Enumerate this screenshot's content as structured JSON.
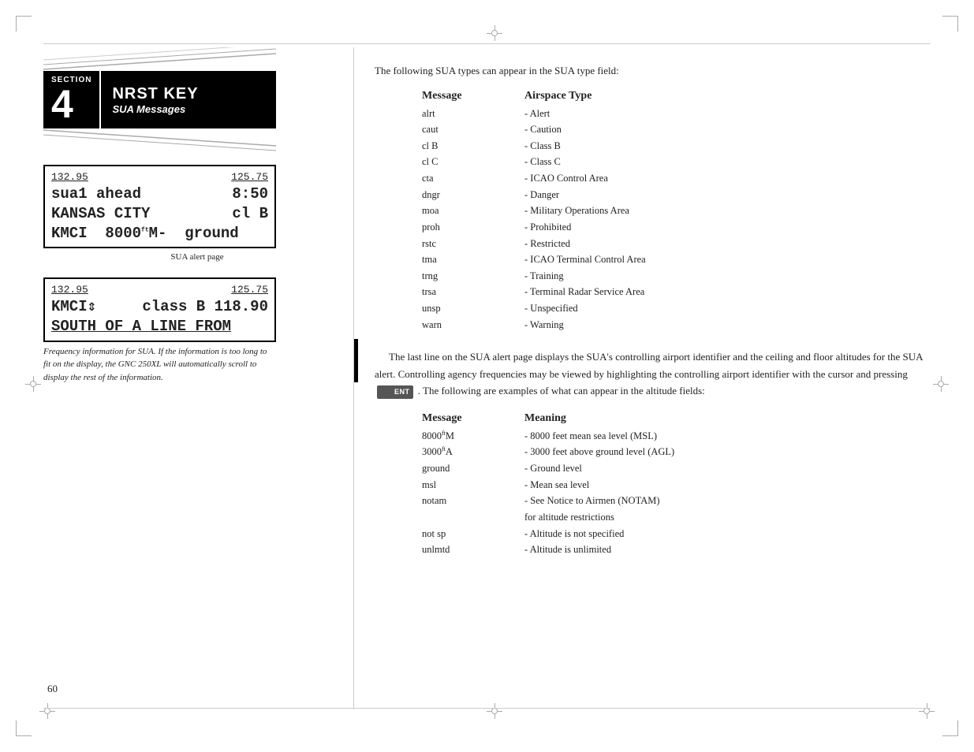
{
  "page": {
    "number": "60",
    "background": "#ffffff"
  },
  "section": {
    "word": "SECTION",
    "number": "4",
    "title_main": "NRST KEY",
    "title_sub": "SUA Messages"
  },
  "left_col": {
    "lcd1": {
      "row1_left": "132.95",
      "row1_right": "125.75",
      "row2_left": "sua1 ahead",
      "row2_right": "8:50",
      "row3_left": "KANSAS CITY",
      "row3_right": "cl B",
      "row4": "KMCI  8000ftM-  ground"
    },
    "caption1": "SUA alert page",
    "lcd2": {
      "row1_left": "132.95",
      "row1_right": "125.75",
      "row2_left": "KMCI⇕",
      "row2_right": "class B 118.90",
      "row3": "SOUTH OF A LINE FROM"
    },
    "caption2_italic": "Frequency information for SUA. If the information is too long to fit on the display, the GNC 250XL will automatically scroll to display the rest of the information."
  },
  "right_col": {
    "intro": "The following SUA types can appear in the SUA type field:",
    "sua_table": {
      "col1_header": "Message",
      "col2_header": "Airspace Type",
      "rows": [
        {
          "msg": "alrt",
          "type": "- Alert"
        },
        {
          "msg": "caut",
          "type": "- Caution"
        },
        {
          "msg": "cl B",
          "type": "- Class B"
        },
        {
          "msg": "cl C",
          "type": "- Class C"
        },
        {
          "msg": "cta",
          "type": "- ICAO Control Area"
        },
        {
          "msg": "dngr",
          "type": "- Danger"
        },
        {
          "msg": "moa",
          "type": "- Military Operations Area"
        },
        {
          "msg": "proh",
          "type": "- Prohibited"
        },
        {
          "msg": "rstc",
          "type": "- Restricted"
        },
        {
          "msg": "tma",
          "type": "- ICAO Terminal Control Area"
        },
        {
          "msg": "trng",
          "type": "- Training"
        },
        {
          "msg": "trsa",
          "type": "- Terminal Radar Service Area"
        },
        {
          "msg": "unsp",
          "type": "- Unspecified"
        },
        {
          "msg": "warn",
          "type": "- Warning"
        }
      ]
    },
    "body_text": "The last line on the SUA alert page displays the SUA's controlling airport identifier and the ceiling and floor altitudes for the SUA alert. Controlling agency frequencies may be viewed by highlighting the controlling airport identifier with the cursor and pressing",
    "body_text_cont": ". The following are examples of what can appear in the altitude fields:",
    "ent_label": "ENT",
    "alt_table": {
      "col1_header": "Message",
      "col2_header": "Meaning",
      "rows": [
        {
          "msg": "8000ftM",
          "meaning": "- 8000 feet mean sea level (MSL)"
        },
        {
          "msg": "3000ftA",
          "meaning": "- 3000 feet above ground level (AGL)"
        },
        {
          "msg": "ground",
          "meaning": "- Ground level"
        },
        {
          "msg": "msl",
          "meaning": "- Mean sea level"
        },
        {
          "msg": "notam",
          "meaning": "- See Notice to Airmen (NOTAM)",
          "meaning2": "  for altitude restrictions"
        },
        {
          "msg": "not sp",
          "meaning": "- Altitude is not specified"
        },
        {
          "msg": "unlmtd",
          "meaning": "- Altitude is unlimited"
        }
      ]
    }
  }
}
